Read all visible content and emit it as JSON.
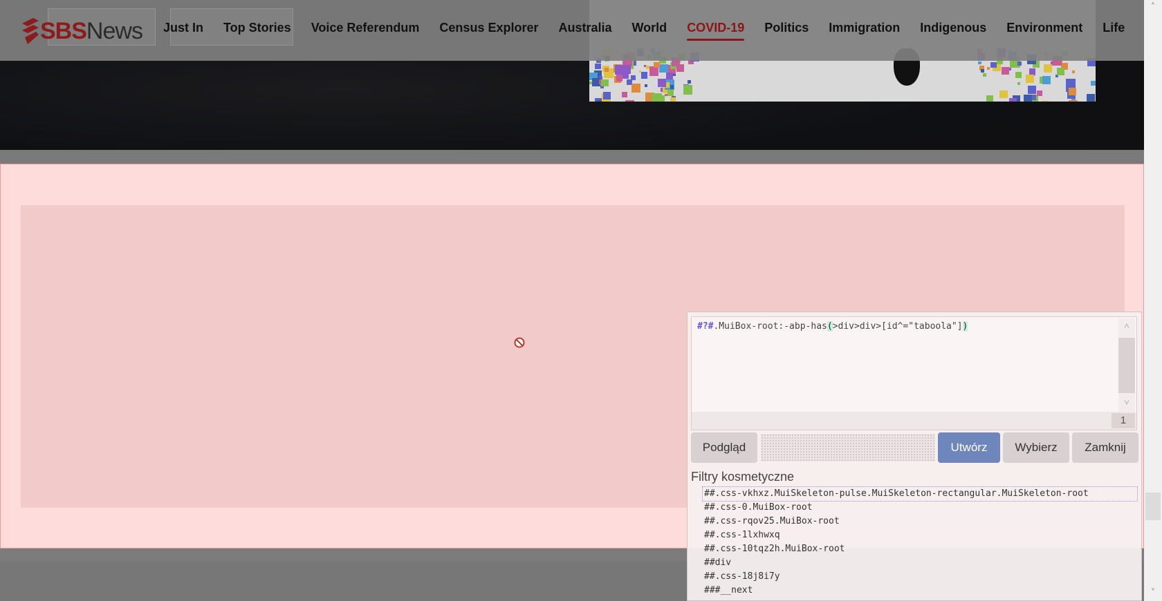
{
  "site": {
    "logo_primary": "SBS",
    "logo_secondary": "News",
    "nav_items": [
      {
        "label": "Just In"
      },
      {
        "label": "Top Stories"
      },
      {
        "label": "Voice Referendum"
      },
      {
        "label": "Census Explorer"
      },
      {
        "label": "Australia"
      },
      {
        "label": "World"
      },
      {
        "label": "COVID-19",
        "active": true
      },
      {
        "label": "Politics"
      },
      {
        "label": "Immigration"
      },
      {
        "label": "Indigenous"
      },
      {
        "label": "Environment"
      },
      {
        "label": "Life"
      }
    ],
    "accent_color": "#8d1515"
  },
  "dialog": {
    "editor": {
      "filter_prefix": "#?#",
      "filter_selector": ".MuiBox-root:-abp-has",
      "paren_open": "(",
      "filter_argument": ">div>div>[id^=\"taboola\"]",
      "paren_close": ")",
      "line_count": "1"
    },
    "buttons": {
      "preview": "Podgląd",
      "create": "Utwórz",
      "pick": "Wybierz",
      "close": "Zamknij"
    },
    "section_title": "Filtry kosmetyczne",
    "filters": [
      "##.css-vkhxz.MuiSkeleton-pulse.MuiSkeleton-rectangular.MuiSkeleton-root",
      "##.css-0.MuiBox-root",
      "##.css-rqov25.MuiBox-root",
      "##.css-1lxhwxq",
      "##.css-10tqz2h.MuiBox-root",
      "##div",
      "##.css-18j8i7y",
      "###__next"
    ],
    "primary_color": "#6f86bd"
  },
  "highlight_color": "#ffdcdc",
  "icons": {
    "blocked": "no-entry-icon",
    "scroll_up": "chevron-up-icon",
    "scroll_down": "chevron-down-icon"
  }
}
